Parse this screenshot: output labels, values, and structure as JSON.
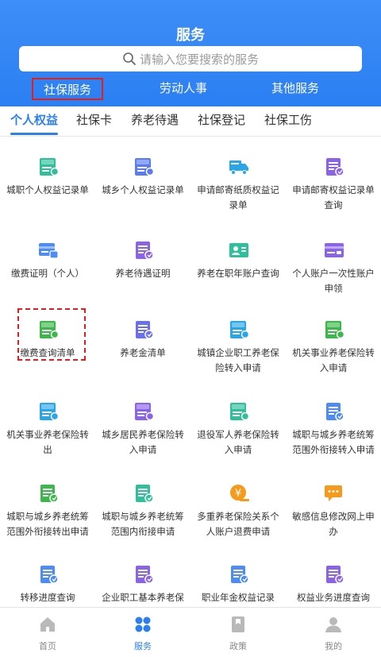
{
  "header": {
    "title": "服务"
  },
  "search": {
    "placeholder": "请输入您要搜索的服务"
  },
  "category_tabs": [
    "社保服务",
    "劳动人事",
    "其他服务"
  ],
  "sub_tabs": [
    "个人权益",
    "社保卡",
    "养老待遇",
    "社保登记",
    "社保工伤"
  ],
  "services": [
    {
      "label": "城职个人权益记录单",
      "icon": "doc-badge-icon",
      "color": "#2fbf9a",
      "badge": "城镇"
    },
    {
      "label": "城乡个人权益记录单",
      "icon": "doc-badge-icon",
      "color": "#5b7cf0",
      "badge": "城乡"
    },
    {
      "label": "申请邮寄纸质权益记录单",
      "icon": "mail-truck-icon",
      "color": "#2aa6e8"
    },
    {
      "label": "申请邮寄权益记录单查询",
      "icon": "doc-search-icon",
      "color": "#8a63e8"
    },
    {
      "label": "缴费证明（个人）",
      "icon": "card-stamp-icon",
      "color": "#4d8cf5"
    },
    {
      "label": "养老待遇证明",
      "icon": "pension-doc-icon",
      "color": "#8a63e8"
    },
    {
      "label": "养老在职年账户查询",
      "icon": "id-card-icon",
      "color": "#2fbf9a"
    },
    {
      "label": "个人账户一次性账户申领",
      "icon": "one-time-icon",
      "color": "#8a63e8"
    },
    {
      "label": "缴费查询清单",
      "icon": "pay-list-icon",
      "color": "#3cb84a",
      "badge": "缴费"
    },
    {
      "label": "养老金清单",
      "icon": "pension-list-icon",
      "color": "#6a6ef0"
    },
    {
      "label": "城镇企业职工养老保险转入申请",
      "icon": "transfer-in-icon",
      "color": "#2aa6e8",
      "badge": "城镇"
    },
    {
      "label": "机关事业养老保险转入申请",
      "icon": "transfer-in-icon",
      "color": "#3cb84a",
      "badge": "城镇"
    },
    {
      "label": "机关事业养老保险转出",
      "icon": "transfer-out-icon",
      "color": "#2aa6e8",
      "badge": "机关"
    },
    {
      "label": "城乡居民养老保险转入申请",
      "icon": "transfer-in-icon",
      "color": "#8a63e8",
      "badge": "城乡"
    },
    {
      "label": "退役军人养老保险转入申请",
      "icon": "transfer-in-icon",
      "color": "#2fbf9a",
      "badge": "军人"
    },
    {
      "label": "城职与城乡养老统筹范围外衔接转入申请",
      "icon": "link-in-icon",
      "color": "#4d8cf5"
    },
    {
      "label": "城职与城乡养老统筹范围外衔接转出申请",
      "icon": "link-out-icon",
      "color": "#3cb84a"
    },
    {
      "label": "城职与城乡养老统筹范围内衔接申请",
      "icon": "edit-doc-icon",
      "color": "#2fbf9a"
    },
    {
      "label": "多重养老保险关系个人账户退费申请",
      "icon": "yuan-refund-icon",
      "color": "#f59a1b"
    },
    {
      "label": "敏感信息修改网上申办",
      "icon": "message-edit-icon",
      "color": "#f59a1b"
    },
    {
      "label": "转移进度查询",
      "icon": "progress-doc-icon",
      "color": "#4d8cf5"
    },
    {
      "label": "企业职工基本养老保险信息核对单打印",
      "icon": "check-doc-icon",
      "color": "#8a63e8"
    },
    {
      "label": "职业年金权益记录",
      "icon": "annuity-doc-icon",
      "color": "#4d8cf5"
    },
    {
      "label": "权益业务进度查询",
      "icon": "progress-search-icon",
      "color": "#8a63e8"
    }
  ],
  "bottom_nav": [
    {
      "label": "首页",
      "icon": "home-icon"
    },
    {
      "label": "服务",
      "icon": "services-icon"
    },
    {
      "label": "政策",
      "icon": "policy-icon"
    },
    {
      "label": "我的",
      "icon": "profile-icon"
    }
  ],
  "colors": {
    "primary": "#2b7ff1",
    "highlight": "#e02020"
  }
}
